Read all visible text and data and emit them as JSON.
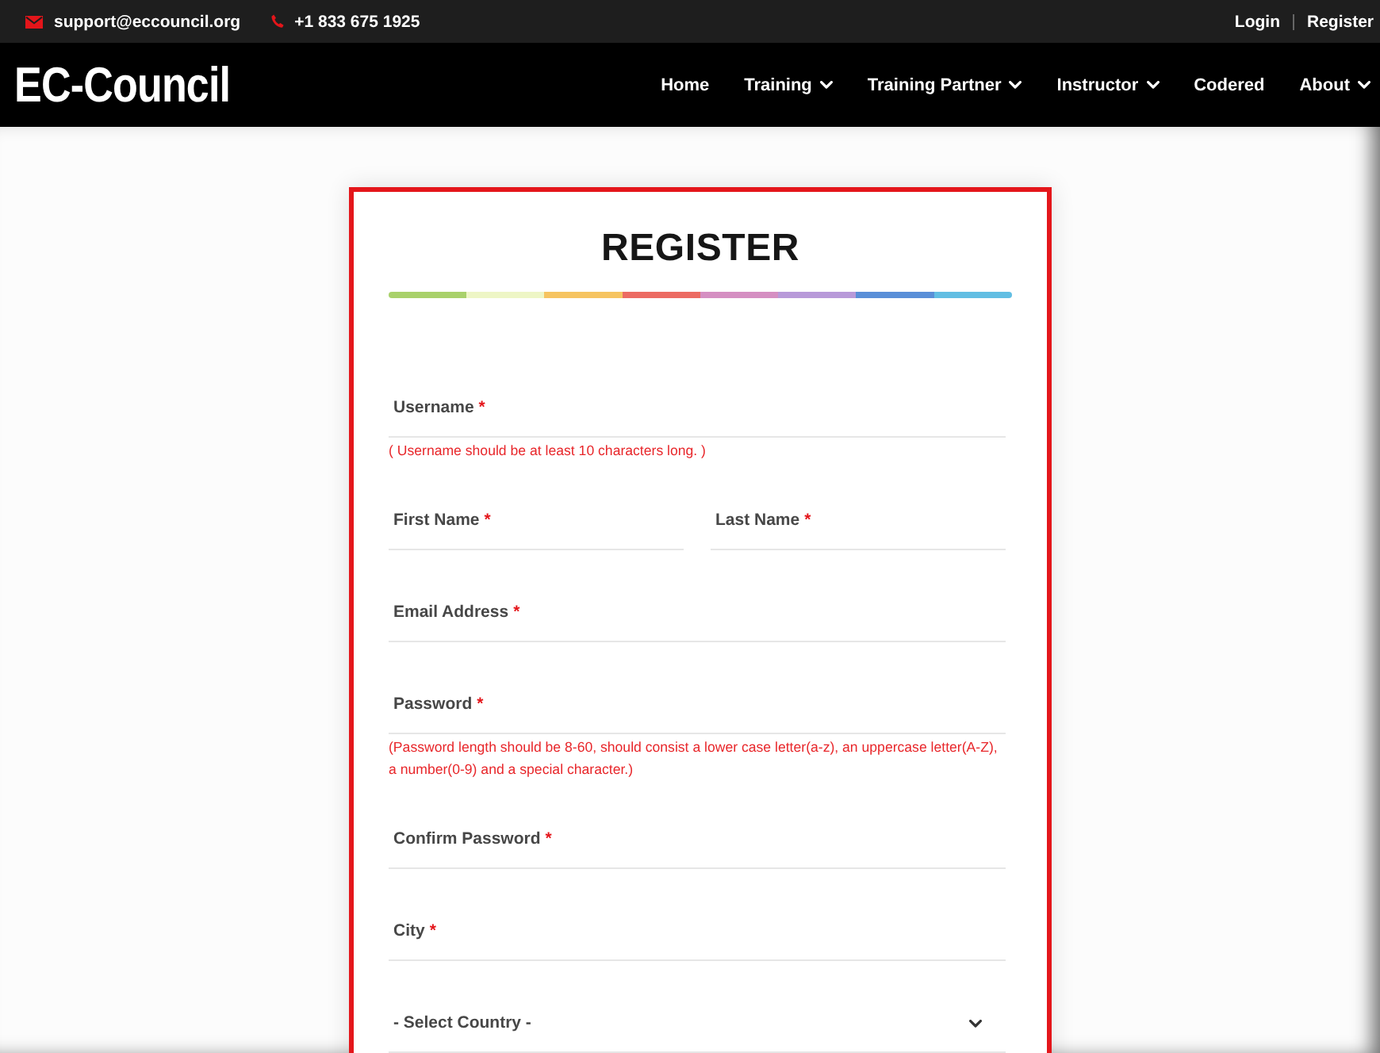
{
  "top_bar": {
    "contacts": [
      {
        "kind": "email",
        "text": "support@eccouncil.org"
      },
      {
        "kind": "phone",
        "text": "+1 833 675 1925"
      }
    ],
    "links": [
      "Login",
      "Register"
    ]
  },
  "nav_bar": {
    "logo": "EC-Council",
    "items": [
      {
        "label": "Home",
        "dropdown": false
      },
      {
        "label": "Training",
        "dropdown": true
      },
      {
        "label": "Training Partner",
        "dropdown": true
      },
      {
        "label": "Instructor",
        "dropdown": true
      },
      {
        "label": "Codered",
        "dropdown": false
      },
      {
        "label": "About",
        "dropdown": true
      }
    ]
  },
  "form": {
    "title": "REGISTER",
    "rows": [
      {
        "fields": [
          {
            "kind": "text",
            "label": "Username",
            "marker": "*"
          }
        ],
        "hint": "( Username should be at least 10 characters long. )"
      },
      {
        "fields": [
          {
            "kind": "text",
            "label": "First Name",
            "marker": "*"
          },
          {
            "kind": "text",
            "label": "Last Name",
            "marker": "*"
          }
        ]
      },
      {
        "fields": [
          {
            "kind": "email",
            "label": "Email Address",
            "marker": "*"
          }
        ]
      },
      {
        "fields": [
          {
            "kind": "password",
            "label": "Password",
            "marker": "*"
          }
        ],
        "hint": "(Password length should be 8-60, should consist a lower case letter(a-z), an uppercase letter(A-Z), a number(0-9) and a special character.)"
      },
      {
        "fields": [
          {
            "kind": "password",
            "label": "Confirm Password",
            "marker": "*"
          }
        ]
      },
      {
        "fields": [
          {
            "kind": "text",
            "label": "City",
            "marker": "*"
          }
        ]
      },
      {
        "fields": [
          {
            "kind": "select",
            "label": "- Select Country -"
          }
        ]
      }
    ]
  }
}
